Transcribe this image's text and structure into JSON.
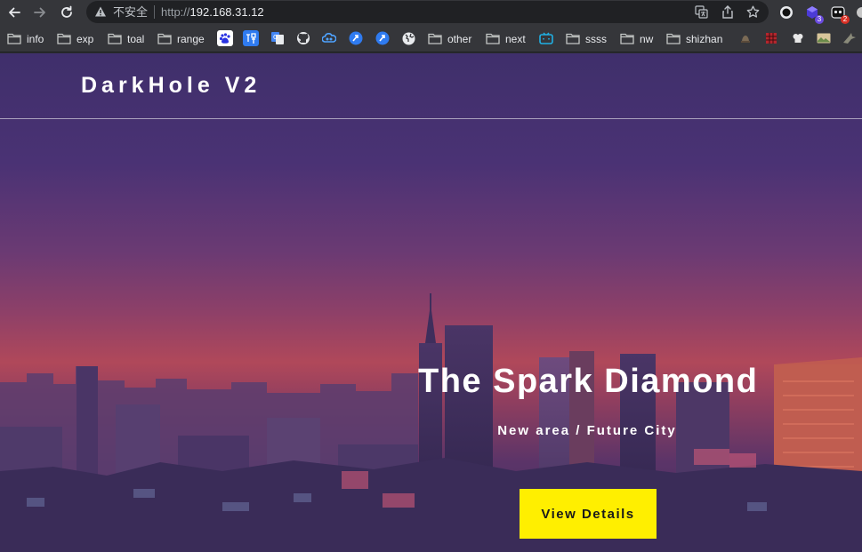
{
  "browser": {
    "security_label": "不安全",
    "url_scheme": "http://",
    "url_host": "192.168.31.12",
    "extensions": [
      {
        "name": "circle-extension-icon"
      },
      {
        "name": "cube-extension-icon",
        "badge": "3",
        "badge_color": "#6b4be0"
      },
      {
        "name": "mask-extension-icon",
        "badge": "2",
        "badge_color": "#d93025"
      }
    ]
  },
  "bookmarks": {
    "folders": [
      "info",
      "exp",
      "toal",
      "range",
      "other",
      "next",
      "ssss",
      "nw",
      "shizhan"
    ],
    "icons": [
      "baidu-icon",
      "translate-xiang-icon",
      "google-translate-icon",
      "github-icon",
      "cloud-icon",
      "blue-arrow-icon",
      "blue-arrow-icon-2",
      "globe-icon",
      "bilibili-icon"
    ]
  },
  "site": {
    "logo": "DarkHole V2",
    "hero_title": "The Spark Diamond",
    "hero_subtitle": "New area / Future City",
    "cta_label": "View Details"
  },
  "colors": {
    "cta": "#ffef00",
    "chrome_bg": "#35363a",
    "omnibox_bg": "#202124"
  }
}
